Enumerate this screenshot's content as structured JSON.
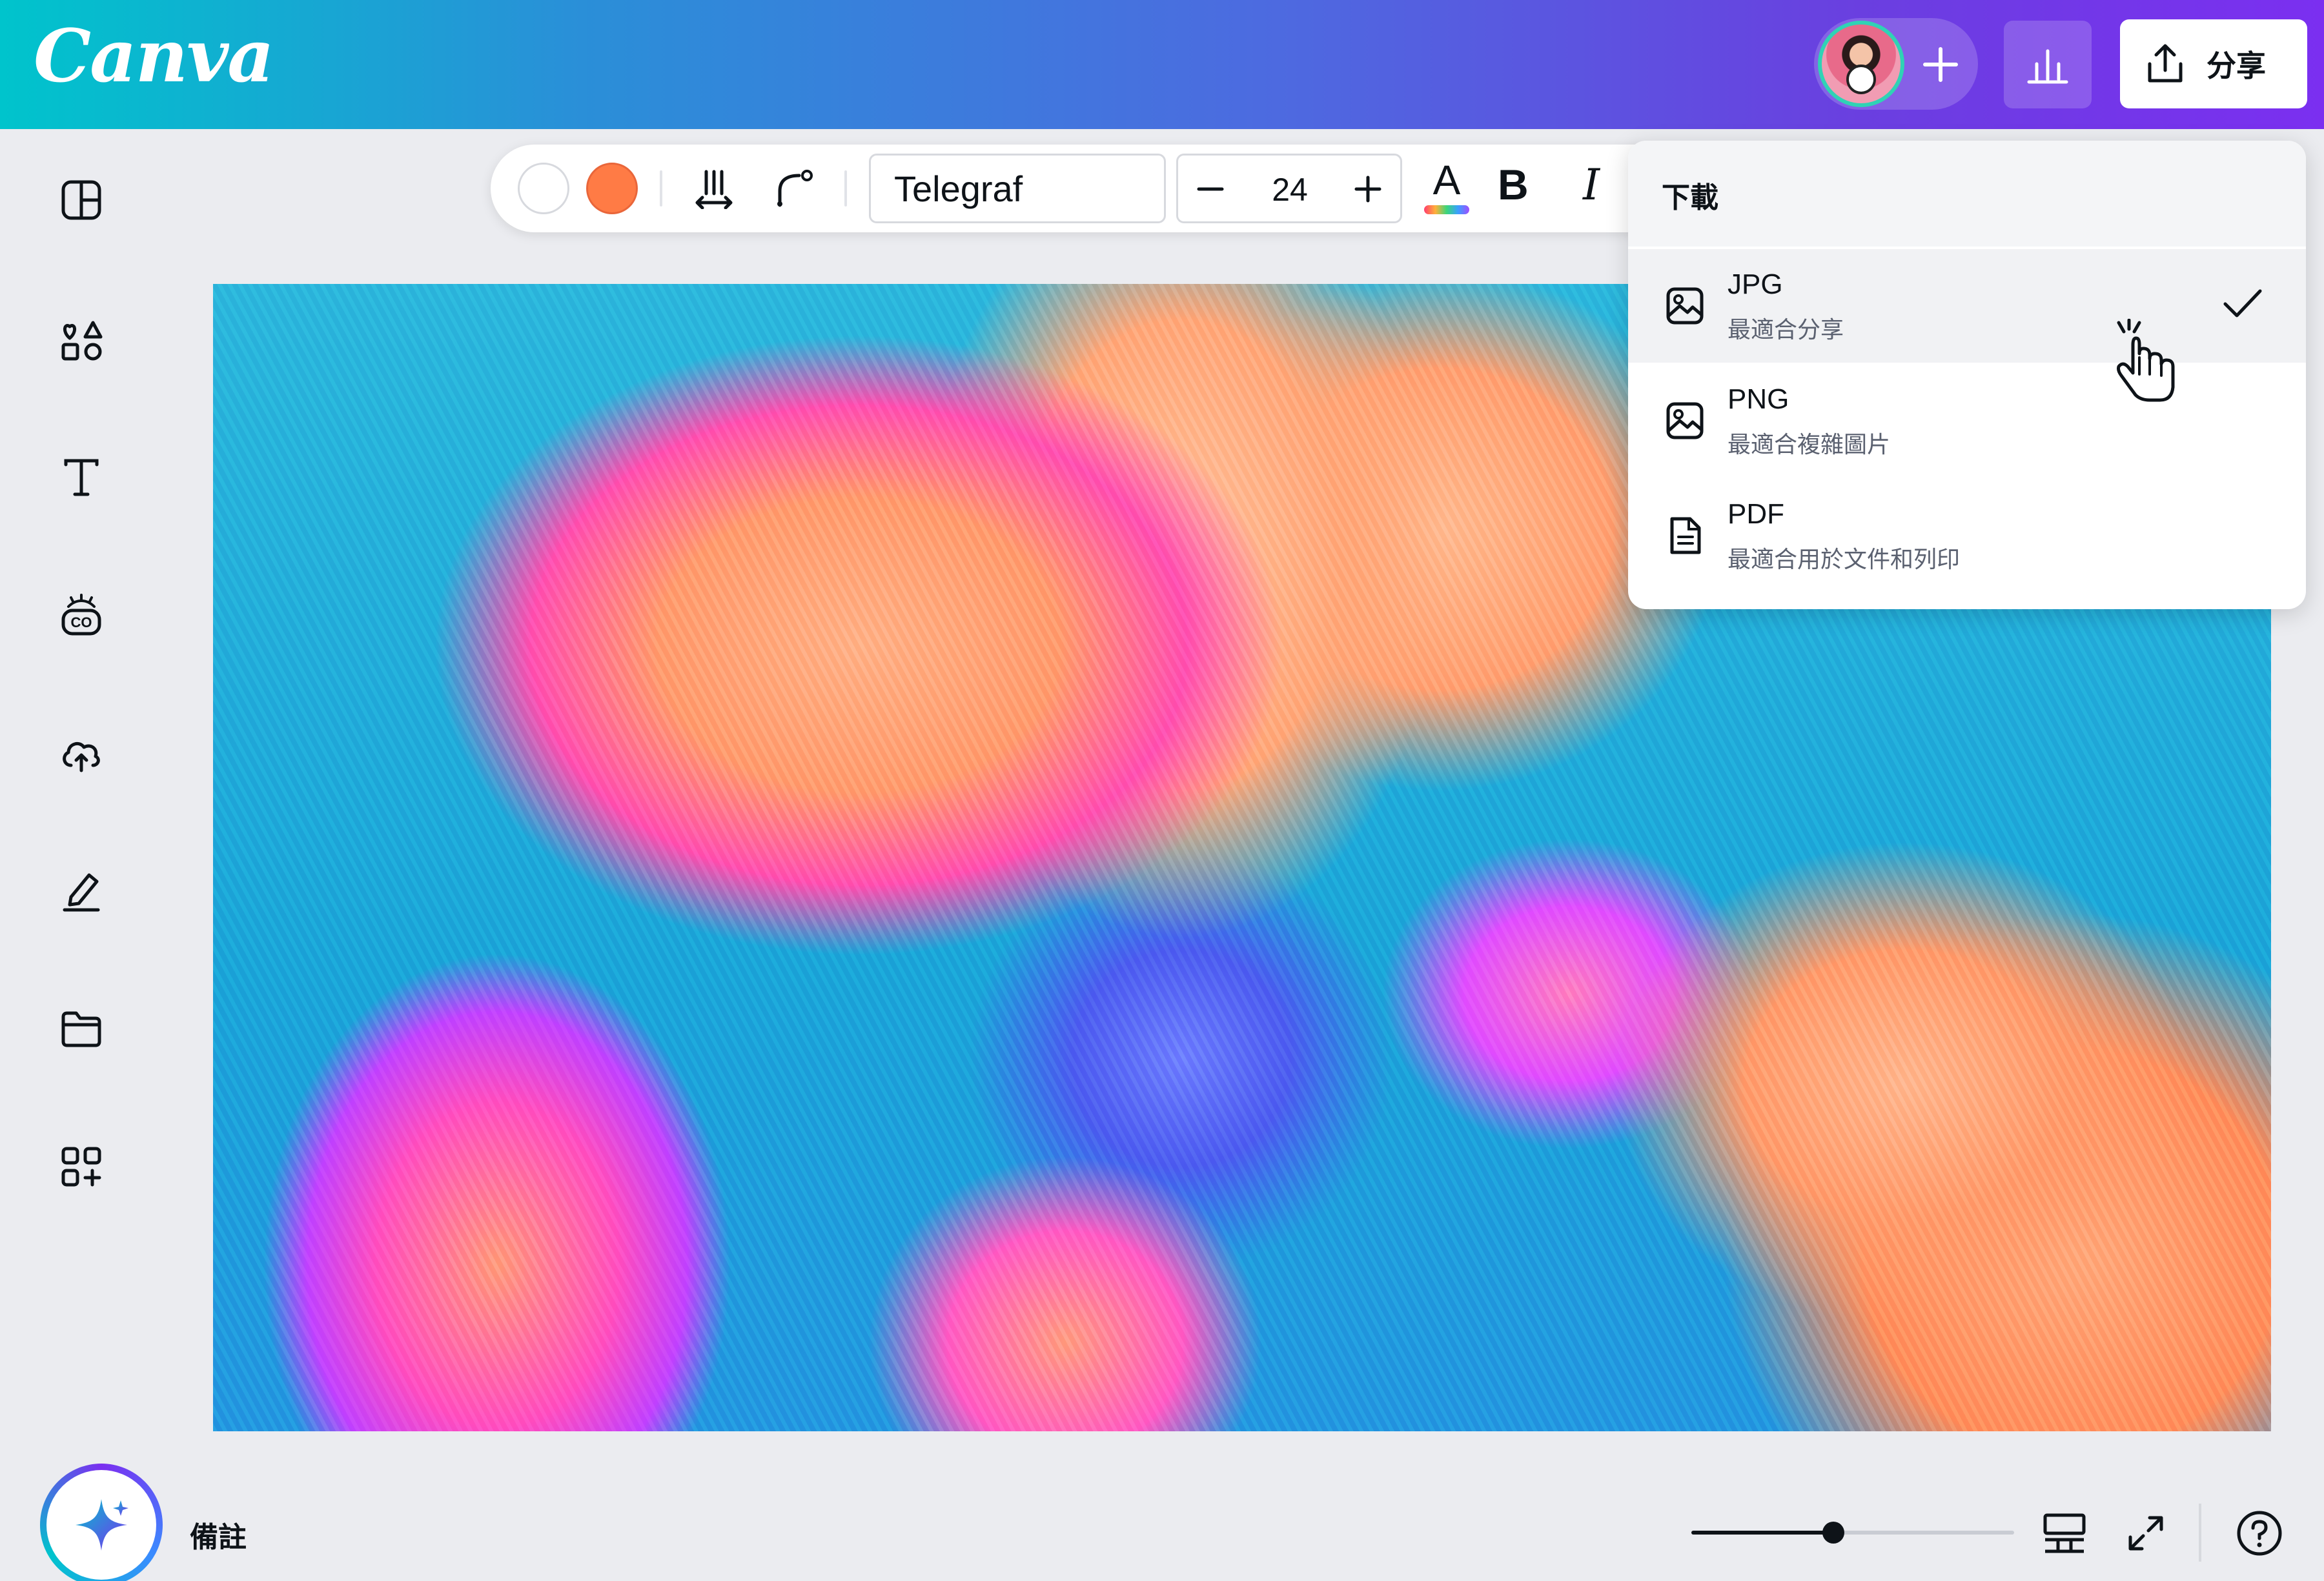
{
  "header": {
    "logo": "Canva",
    "share_label": "分享",
    "gradient_colors": [
      "#00c4cc",
      "#7b2ff0"
    ]
  },
  "sidebar": {
    "items": [
      {
        "icon": "design-panel-icon"
      },
      {
        "icon": "elements-icon"
      },
      {
        "icon": "text-icon"
      },
      {
        "icon": "brand-icon"
      },
      {
        "icon": "uploads-icon"
      },
      {
        "icon": "draw-icon"
      },
      {
        "icon": "projects-folder-icon"
      },
      {
        "icon": "apps-icon"
      }
    ]
  },
  "toolbar": {
    "swatch_colors": [
      "#ffffff",
      "#ff7b45"
    ],
    "font_name": "Telegraf",
    "font_size": "24",
    "text_color_glyph": "A",
    "bold_glyph": "B",
    "italic_glyph": "I"
  },
  "download_menu": {
    "title": "下載",
    "options": [
      {
        "name": "JPG",
        "description": "最適合分享",
        "icon": "image-icon",
        "selected": true
      },
      {
        "name": "PNG",
        "description": "最適合複雜圖片",
        "icon": "image-icon",
        "selected": false
      },
      {
        "name": "PDF",
        "description": "最適合用於文件和列印",
        "icon": "document-icon",
        "selected": false
      }
    ]
  },
  "bottom_bar": {
    "notes_label": "備註",
    "zoom_fraction": 0.44
  }
}
